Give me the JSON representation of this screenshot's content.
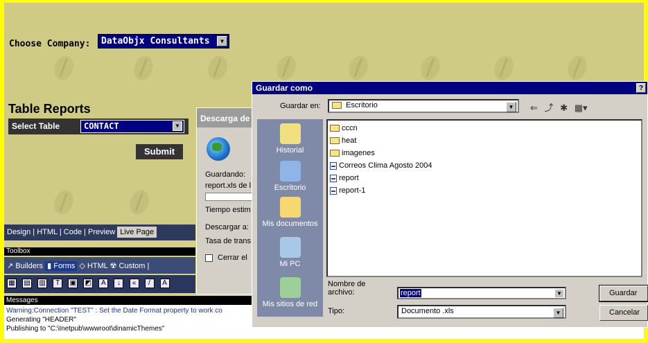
{
  "page": {
    "choose_company_label": "Choose Company:",
    "company_selected": "DataObjx Consultants",
    "table_reports_title": "Table Reports",
    "select_table_label": "Select Table",
    "table_selected": "CONTACT",
    "submit_label": "Submit"
  },
  "ide": {
    "view_tabs": [
      "Design",
      "HTML",
      "Code",
      "Preview",
      "Live Page"
    ],
    "toolbox_title": "Toolbox",
    "toolbox_tabs": [
      "Builders",
      "Forms",
      "HTML",
      "Custom"
    ],
    "messages_title": "Messages",
    "messages": [
      "Warning:Connection \"TEST\" : Set the Date Format property to work co",
      "Generating \"HEADER\"",
      "Publishing to \"C:\\Inetpub\\wwwroot\\dinamicThemes\""
    ]
  },
  "download_dialog": {
    "title": "Descarga de",
    "saving_label": "Guardando:",
    "saving_file": "report.xls de l",
    "time_label": "Tiempo estim",
    "download_to_label": "Descargar a:",
    "rate_label": "Tasa de trans",
    "close_label": "Cerrar el"
  },
  "save_dialog": {
    "title": "Guardar como",
    "help_label": "?",
    "save_in_label": "Guardar en:",
    "save_in_value": "Escritorio",
    "places": [
      "Historial",
      "Escritorio",
      "Mis documentos",
      "Mi PC",
      "Mis sitios de red"
    ],
    "files": [
      {
        "name": "cccn",
        "type": "folder"
      },
      {
        "name": "heat",
        "type": "folder"
      },
      {
        "name": "imagenes",
        "type": "folder"
      },
      {
        "name": "Correos Clima Agosto 2004",
        "type": "doc"
      },
      {
        "name": "report",
        "type": "doc"
      },
      {
        "name": "report-1",
        "type": "doc"
      }
    ],
    "filename_label": "Nombre de archivo:",
    "filename_value": "report",
    "type_label": "Tipo:",
    "type_value": "Documento .xls",
    "save_button": "Guardar",
    "cancel_button": "Cancelar"
  },
  "colors": {
    "frame": "#ffff00",
    "page_background": "#cfca84",
    "selection": "#000080"
  }
}
